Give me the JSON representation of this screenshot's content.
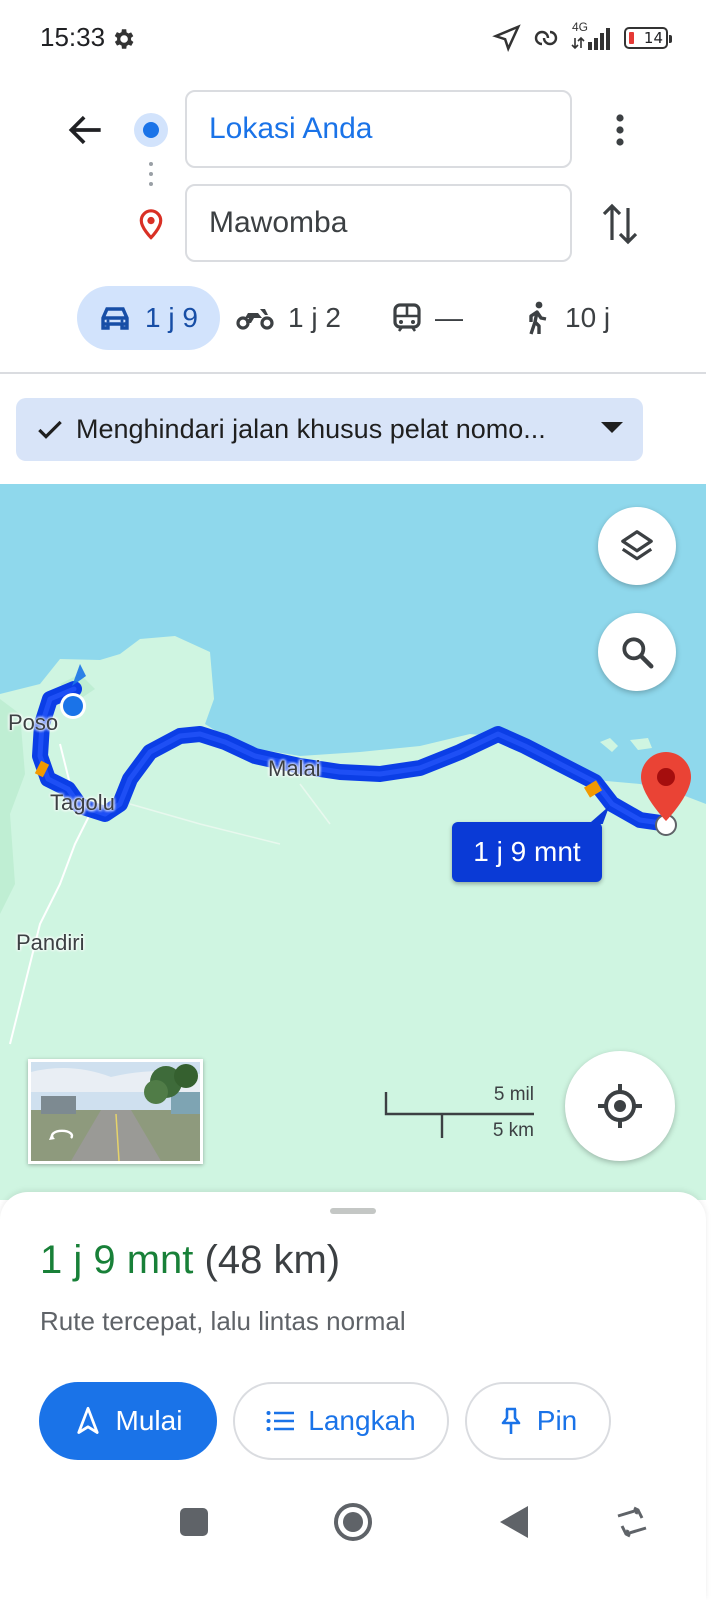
{
  "status_bar": {
    "time": "15:33",
    "network": "4G",
    "battery": "14"
  },
  "route": {
    "origin": "Lokasi Anda",
    "destination": "Mawomba"
  },
  "modes": [
    {
      "icon": "car-icon",
      "label": "1 j 9",
      "active": true
    },
    {
      "icon": "motorcycle-icon",
      "label": "1 j 2",
      "active": false
    },
    {
      "icon": "train-icon",
      "label": "—",
      "active": false
    },
    {
      "icon": "walk-icon",
      "label": "10 j",
      "active": false
    }
  ],
  "avoid_filter": {
    "label": "Menghindari jalan khusus pelat nomo..."
  },
  "map": {
    "places": [
      "Poso",
      "Tagolu",
      "Malai",
      "Pandiri"
    ],
    "eta_label": "1 j 9 mnt",
    "scale": {
      "imperial": "5 mil",
      "metric": "5 km"
    },
    "colors": {
      "water": "#8fd8ec",
      "land": "#cff5e1",
      "route": "#0b3ee6",
      "pin": "#ea4335"
    }
  },
  "sheet": {
    "duration": "1 j 9 mnt",
    "distance": "(48 km)",
    "description": "Rute tercepat, lalu lintas normal",
    "buttons": {
      "start": "Mulai",
      "steps": "Langkah",
      "pin": "Pin"
    }
  }
}
